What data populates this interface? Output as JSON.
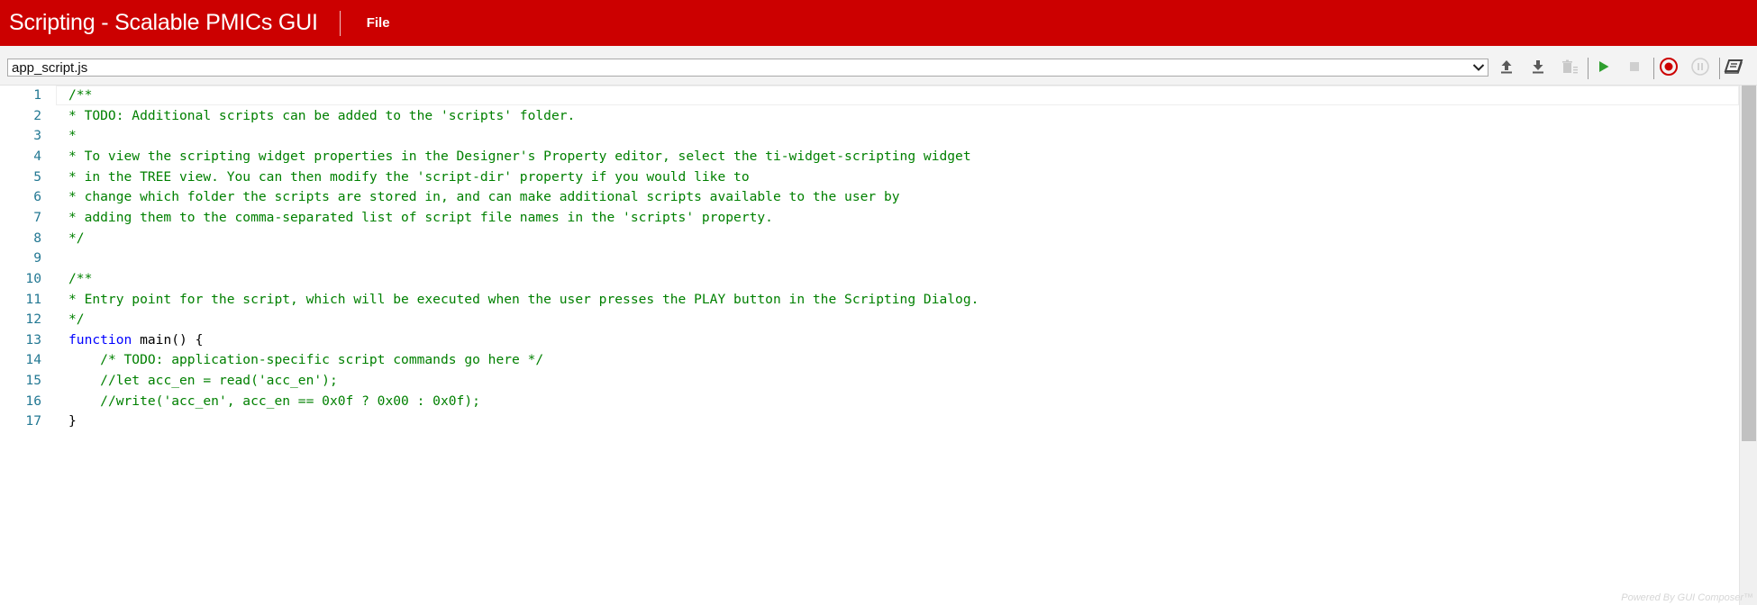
{
  "header": {
    "title": "Scripting - Scalable PMICs GUI",
    "menu": [
      {
        "label": "File"
      }
    ],
    "background_color": "#cc0000"
  },
  "toolbar": {
    "file_select": {
      "selected": "app_script.js",
      "options": [
        "app_script.js"
      ]
    },
    "buttons": [
      {
        "name": "upload",
        "icon": "upload-icon",
        "enabled": true
      },
      {
        "name": "download",
        "icon": "download-icon",
        "enabled": true
      },
      {
        "name": "delete",
        "icon": "delete-icon",
        "enabled": false
      },
      {
        "name": "play",
        "icon": "play-icon",
        "enabled": true,
        "color": "#2e9e2e"
      },
      {
        "name": "stop",
        "icon": "stop-icon",
        "enabled": false
      },
      {
        "name": "record",
        "icon": "record-icon",
        "enabled": true,
        "color": "#cc0000"
      },
      {
        "name": "pause",
        "icon": "pause-icon",
        "enabled": false
      },
      {
        "name": "help",
        "icon": "book-icon",
        "enabled": true
      }
    ]
  },
  "editor": {
    "lines": [
      {
        "number": "1",
        "tokens": [
          {
            "type": "comment",
            "text": "/**"
          }
        ]
      },
      {
        "number": "2",
        "tokens": [
          {
            "type": "comment",
            "text": "* TODO: Additional scripts can be added to the 'scripts' folder."
          }
        ]
      },
      {
        "number": "3",
        "tokens": [
          {
            "type": "comment",
            "text": "*"
          }
        ]
      },
      {
        "number": "4",
        "tokens": [
          {
            "type": "comment",
            "text": "* To view the scripting widget properties in the Designer's Property editor, select the ti-widget-scripting widget"
          }
        ]
      },
      {
        "number": "5",
        "tokens": [
          {
            "type": "comment",
            "text": "* in the TREE view. You can then modify the 'script-dir' property if you would like to"
          }
        ]
      },
      {
        "number": "6",
        "tokens": [
          {
            "type": "comment",
            "text": "* change which folder the scripts are stored in, and can make additional scripts available to the user by"
          }
        ]
      },
      {
        "number": "7",
        "tokens": [
          {
            "type": "comment",
            "text": "* adding them to the comma-separated list of script file names in the 'scripts' property."
          }
        ]
      },
      {
        "number": "8",
        "tokens": [
          {
            "type": "comment",
            "text": "*/"
          }
        ]
      },
      {
        "number": "9",
        "tokens": []
      },
      {
        "number": "10",
        "tokens": [
          {
            "type": "comment",
            "text": "/**"
          }
        ]
      },
      {
        "number": "11",
        "tokens": [
          {
            "type": "comment",
            "text": "* Entry point for the script, which will be executed when the user presses the PLAY button in the Scripting Dialog."
          }
        ]
      },
      {
        "number": "12",
        "tokens": [
          {
            "type": "comment",
            "text": "*/"
          }
        ]
      },
      {
        "number": "13",
        "tokens": [
          {
            "type": "keyword",
            "text": "function"
          },
          {
            "type": "plain",
            "text": " main() {"
          }
        ]
      },
      {
        "number": "14",
        "tokens": [
          {
            "type": "plain",
            "text": "    "
          },
          {
            "type": "comment",
            "text": "/* TODO: application-specific script commands go here */"
          }
        ]
      },
      {
        "number": "15",
        "tokens": [
          {
            "type": "plain",
            "text": "    "
          },
          {
            "type": "comment",
            "text": "//let acc_en = read('acc_en');"
          }
        ]
      },
      {
        "number": "16",
        "tokens": [
          {
            "type": "plain",
            "text": "    "
          },
          {
            "type": "comment",
            "text": "//write('acc_en', acc_en == 0x0f ? 0x00 : 0x0f);"
          }
        ]
      },
      {
        "number": "17",
        "tokens": [
          {
            "type": "plain",
            "text": "}"
          }
        ]
      }
    ],
    "colors": {
      "line_number": "#237893",
      "comment": "#008000",
      "keyword": "#0000ff",
      "plain": "#000000"
    }
  },
  "footer": {
    "powered_by": "Powered By GUI Composer™"
  }
}
